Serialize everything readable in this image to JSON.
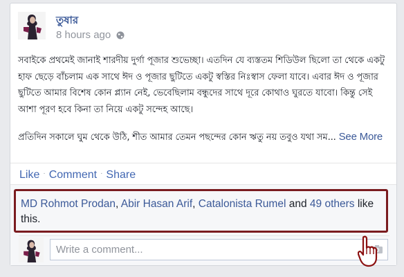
{
  "post": {
    "author": "তুষার",
    "time": "8 hours ago",
    "privacy_icon": "globe-icon",
    "paragraph1": "সবাইকে প্রথমেই জানাই শারদীয় দুর্গা পূজার শুভেচ্ছা। এতদিন যে ব্যস্ততম শিডিউল ছিলো তা থেকে একটু হাফ ছেড়ে বাঁচলাম এক সাথে ঈদ ও পূজার ছুটিতে একটু স্বস্তির নিঃস্বাস ফেলা যাবে। এবার ঈদ ও পূজার ছুটিতে আমার বিশেষ কোন প্ল্যান নেই, ভেবেছিলাম বন্ধুদের সাথে দূরে কোথাও ঘুরতে যাবো। কিন্তু সেই আশা পূরণ হবে কিনা তা নিয়ে একটু সন্দেহ আছে।",
    "paragraph2": "প্রতিদিন সকালে ঘুম থেকে উঠি, শীত আমার তেমন পছন্দের কোন ঋতু নয় তবুও যথা সম...",
    "see_more": "See More"
  },
  "actions": {
    "like": "Like",
    "comment": "Comment",
    "share": "Share",
    "separator": "·"
  },
  "likes": {
    "names": [
      "MD Rohmot Prodan",
      "Abir Hasan Arif",
      "Catalonista Rumel"
    ],
    "comma": ", ",
    "and": " and ",
    "others": "49 others",
    "suffix": " like this."
  },
  "comment": {
    "placeholder": "Write a comment...",
    "camera_icon": "camera-icon"
  },
  "colors": {
    "link": "#3b5998",
    "highlight_border": "#7a1b1f",
    "background": "#e9eaed"
  }
}
